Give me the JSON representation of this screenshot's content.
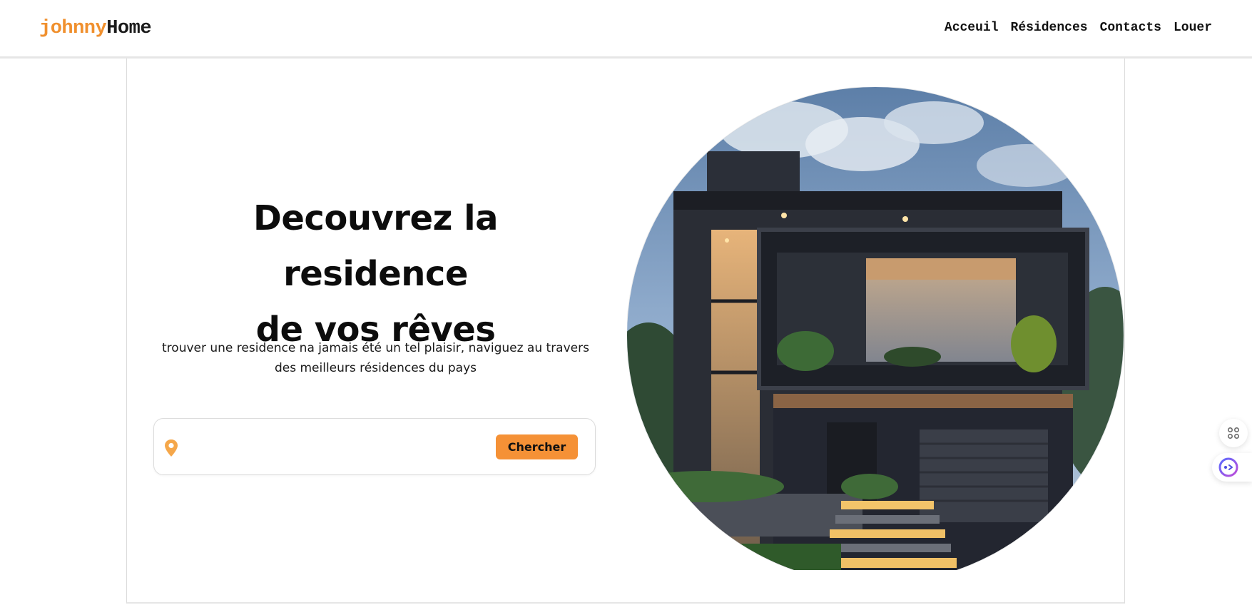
{
  "header": {
    "logo_accent": "johnny",
    "logo_rest": "Home",
    "nav": [
      "Acceuil",
      "Résidences",
      "Contacts",
      "Louer"
    ]
  },
  "hero": {
    "title_line1": "Decouvrez la residence",
    "title_line2": "de vos rêves",
    "subtitle_line1": "trouver une residence na jamais été un tel plaisir, naviguez au travers",
    "subtitle_line2": "des meilleurs résidences du pays"
  },
  "search": {
    "placeholder": "",
    "button_label": "Chercher",
    "icon": "location-pin-icon"
  },
  "floating": {
    "icons": [
      "command-icon",
      "assistant-icon"
    ]
  },
  "colors": {
    "accent": "#f0902e",
    "button": "#f59136"
  }
}
